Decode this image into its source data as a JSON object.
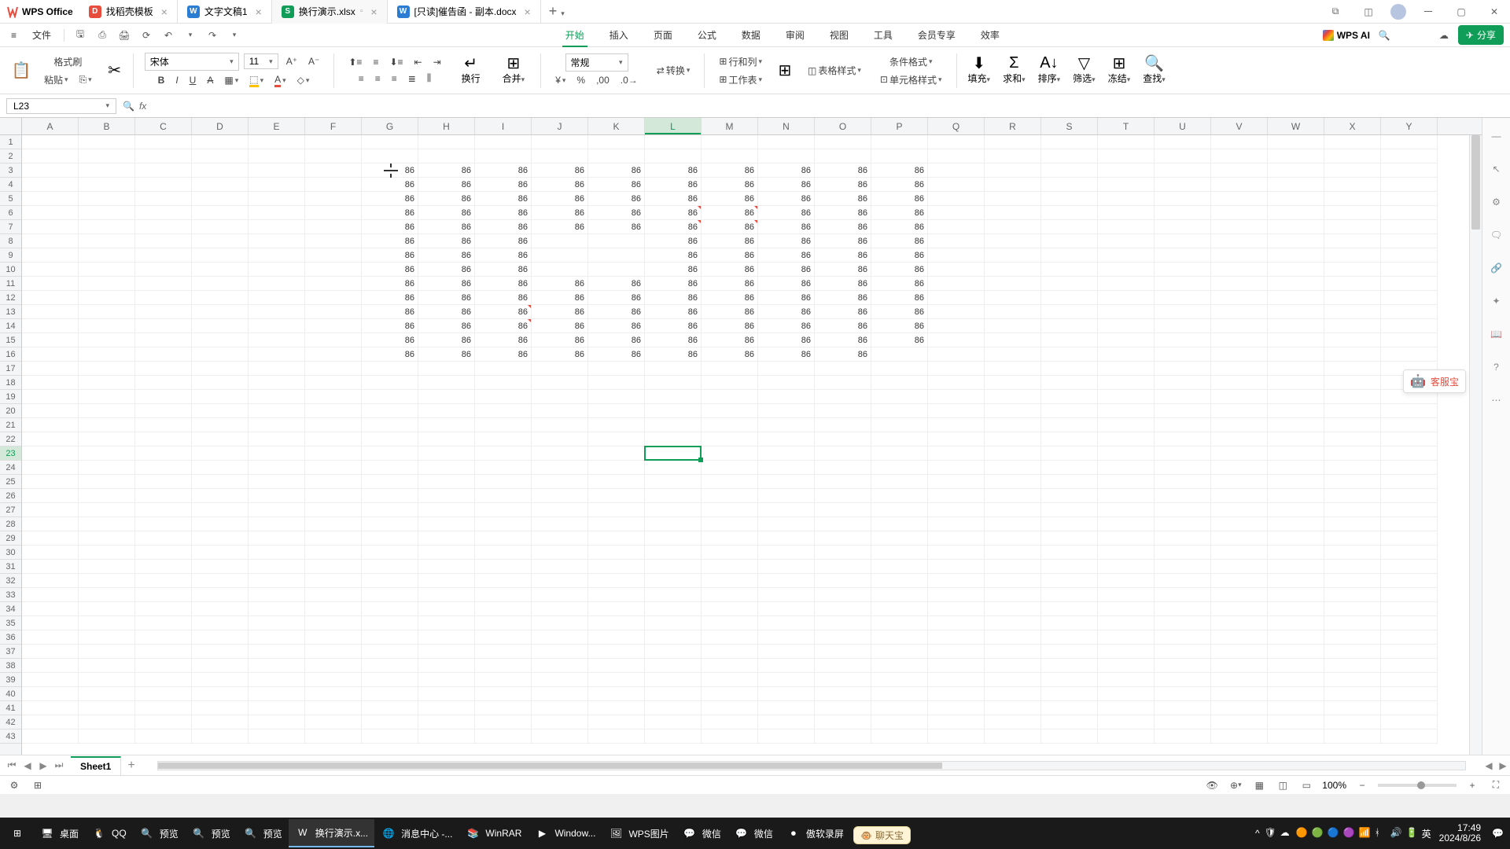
{
  "app": {
    "name": "WPS Office"
  },
  "tabs": [
    {
      "icon": "d",
      "label": "找稻壳模板"
    },
    {
      "icon": "w",
      "label": "文字文稿1"
    },
    {
      "icon": "s",
      "label": "换行演示.xlsx",
      "active": true
    },
    {
      "icon": "w",
      "label": "[只读]催告函 - 副本.docx"
    }
  ],
  "menu": {
    "file": "文件"
  },
  "share": "分享",
  "ribbon_tabs": [
    "开始",
    "插入",
    "页面",
    "公式",
    "数据",
    "审阅",
    "视图",
    "工具",
    "会员专享",
    "效率"
  ],
  "wps_ai": "WPS AI",
  "toolbar": {
    "format_painter": "格式刷",
    "paste": "粘贴",
    "font": "宋体",
    "size": "11",
    "currency_fmt": "常规",
    "convert": "转换",
    "row_col": "行和列",
    "table_style": "表格样式",
    "worksheet": "工作表",
    "cond_fmt": "条件格式",
    "cell_style": "单元格样式",
    "fill": "填充",
    "sum": "求和",
    "sort": "排序",
    "filter": "筛选",
    "freeze": "冻结",
    "find": "查找",
    "wrap": "换行",
    "merge": "合并"
  },
  "name_box": "L23",
  "columns": [
    "A",
    "B",
    "C",
    "D",
    "E",
    "F",
    "G",
    "H",
    "I",
    "J",
    "K",
    "L",
    "M",
    "N",
    "O",
    "P",
    "Q",
    "R",
    "S",
    "T",
    "U",
    "V",
    "W",
    "X",
    "Y"
  ],
  "active": {
    "col": "L",
    "row": 23,
    "col_idx": 11
  },
  "row_count": 43,
  "cell_value": "86",
  "data_map": {
    "3": [
      "G",
      "H",
      "I",
      "J",
      "K",
      "L",
      "M",
      "N",
      "O",
      "P"
    ],
    "4": [
      "G",
      "H",
      "I",
      "J",
      "K",
      "L",
      "M",
      "N",
      "O",
      "P"
    ],
    "5": [
      "G",
      "H",
      "I",
      "J",
      "K",
      "L",
      "M",
      "N",
      "O",
      "P"
    ],
    "6": [
      "G",
      "H",
      "I",
      "J",
      "K",
      "L",
      "M",
      "N",
      "O",
      "P"
    ],
    "7": [
      "G",
      "H",
      "I",
      "J",
      "K",
      "L",
      "M",
      "N",
      "O",
      "P"
    ],
    "8": [
      "G",
      "H",
      "I",
      "L",
      "M",
      "N",
      "O",
      "P"
    ],
    "9": [
      "G",
      "H",
      "I",
      "L",
      "M",
      "N",
      "O",
      "P"
    ],
    "10": [
      "G",
      "H",
      "I",
      "L",
      "M",
      "N",
      "O",
      "P"
    ],
    "11": [
      "G",
      "H",
      "I",
      "J",
      "K",
      "L",
      "M",
      "N",
      "O",
      "P"
    ],
    "12": [
      "G",
      "H",
      "I",
      "J",
      "K",
      "L",
      "M",
      "N",
      "O",
      "P"
    ],
    "13": [
      "G",
      "H",
      "I",
      "J",
      "K",
      "L",
      "M",
      "N",
      "O",
      "P"
    ],
    "14": [
      "G",
      "H",
      "I",
      "J",
      "K",
      "L",
      "M",
      "N",
      "O",
      "P"
    ],
    "15": [
      "G",
      "H",
      "I",
      "J",
      "K",
      "L",
      "M",
      "N",
      "O",
      "P"
    ],
    "16": [
      "G",
      "H",
      "I",
      "J",
      "K",
      "L",
      "M",
      "N",
      "O"
    ]
  },
  "marks": [
    [
      "L",
      6
    ],
    [
      "M",
      6
    ],
    [
      "L",
      7
    ],
    [
      "M",
      7
    ],
    [
      "I",
      13
    ],
    [
      "I",
      14
    ]
  ],
  "sheet_tab": "Sheet1",
  "float_label": "客服宝",
  "zoom": "100%",
  "taskbar": [
    {
      "label": "桌面",
      "icon": "🖥"
    },
    {
      "label": "QQ",
      "icon": "🐧"
    },
    {
      "label": "预览",
      "icon": "🔍"
    },
    {
      "label": "预览",
      "icon": "🔍"
    },
    {
      "label": "预览",
      "icon": "🔍"
    },
    {
      "label": "换行演示.x...",
      "icon": "W",
      "active": true
    },
    {
      "label": "消息中心 -...",
      "icon": "🌐"
    },
    {
      "label": "WinRAR",
      "icon": "📚"
    },
    {
      "label": "Window...",
      "icon": "▶"
    },
    {
      "label": "WPS图片",
      "icon": "🖼"
    },
    {
      "label": "微信",
      "icon": "💬"
    },
    {
      "label": "微信",
      "icon": "💬"
    },
    {
      "label": "傲软录屏",
      "icon": "⏺"
    }
  ],
  "chat_popup": "聊天宝",
  "clock": {
    "time": "17:49",
    "date": "2024/8/26"
  },
  "ime": "英"
}
